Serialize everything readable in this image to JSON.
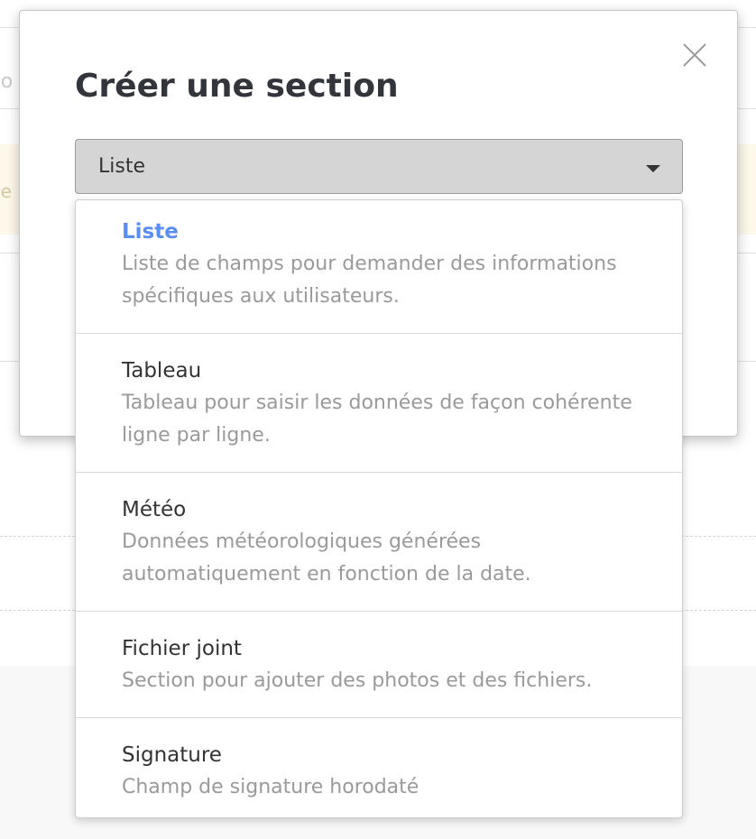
{
  "modal": {
    "title": "Créer une section",
    "select_value": "Liste"
  },
  "background": {
    "cut_text_1": "tio",
    "cut_text_2": "ne"
  },
  "dropdown": {
    "options": [
      {
        "title": "Liste",
        "description": "Liste de champs pour demander des informations spécifiques aux utilisateurs.",
        "selected": true
      },
      {
        "title": "Tableau",
        "description": "Tableau pour saisir les données de façon cohérente ligne par ligne.",
        "selected": false
      },
      {
        "title": "Météo",
        "description": "Données météorologiques générées automatiquement en fonction de la date.",
        "selected": false
      },
      {
        "title": "Fichier joint",
        "description": "Section pour ajouter des photos et des fichiers.",
        "selected": false
      },
      {
        "title": "Signature",
        "description": "Champ de signature horodaté",
        "selected": false
      }
    ]
  },
  "icons": {
    "close": "close-icon",
    "caret": "caret-down-icon"
  },
  "colors": {
    "selected_option": "#5a8ef0",
    "description_text": "#9a9a9a",
    "select_background": "#d5d5d5"
  }
}
